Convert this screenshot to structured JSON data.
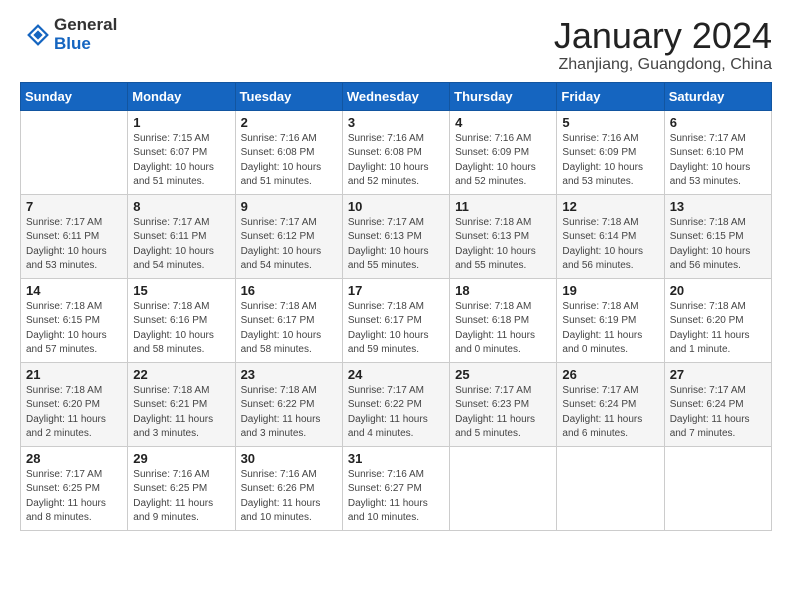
{
  "header": {
    "logo_general": "General",
    "logo_blue": "Blue",
    "title": "January 2024",
    "location": "Zhanjiang, Guangdong, China"
  },
  "weekdays": [
    "Sunday",
    "Monday",
    "Tuesday",
    "Wednesday",
    "Thursday",
    "Friday",
    "Saturday"
  ],
  "weeks": [
    [
      {
        "day": "",
        "sunrise": "",
        "sunset": "",
        "daylight": ""
      },
      {
        "day": "1",
        "sunrise": "7:15 AM",
        "sunset": "6:07 PM",
        "daylight": "10 hours and 51 minutes."
      },
      {
        "day": "2",
        "sunrise": "7:16 AM",
        "sunset": "6:08 PM",
        "daylight": "10 hours and 51 minutes."
      },
      {
        "day": "3",
        "sunrise": "7:16 AM",
        "sunset": "6:08 PM",
        "daylight": "10 hours and 52 minutes."
      },
      {
        "day": "4",
        "sunrise": "7:16 AM",
        "sunset": "6:09 PM",
        "daylight": "10 hours and 52 minutes."
      },
      {
        "day": "5",
        "sunrise": "7:16 AM",
        "sunset": "6:09 PM",
        "daylight": "10 hours and 53 minutes."
      },
      {
        "day": "6",
        "sunrise": "7:17 AM",
        "sunset": "6:10 PM",
        "daylight": "10 hours and 53 minutes."
      }
    ],
    [
      {
        "day": "7",
        "sunrise": "7:17 AM",
        "sunset": "6:11 PM",
        "daylight": "10 hours and 53 minutes."
      },
      {
        "day": "8",
        "sunrise": "7:17 AM",
        "sunset": "6:11 PM",
        "daylight": "10 hours and 54 minutes."
      },
      {
        "day": "9",
        "sunrise": "7:17 AM",
        "sunset": "6:12 PM",
        "daylight": "10 hours and 54 minutes."
      },
      {
        "day": "10",
        "sunrise": "7:17 AM",
        "sunset": "6:13 PM",
        "daylight": "10 hours and 55 minutes."
      },
      {
        "day": "11",
        "sunrise": "7:18 AM",
        "sunset": "6:13 PM",
        "daylight": "10 hours and 55 minutes."
      },
      {
        "day": "12",
        "sunrise": "7:18 AM",
        "sunset": "6:14 PM",
        "daylight": "10 hours and 56 minutes."
      },
      {
        "day": "13",
        "sunrise": "7:18 AM",
        "sunset": "6:15 PM",
        "daylight": "10 hours and 56 minutes."
      }
    ],
    [
      {
        "day": "14",
        "sunrise": "7:18 AM",
        "sunset": "6:15 PM",
        "daylight": "10 hours and 57 minutes."
      },
      {
        "day": "15",
        "sunrise": "7:18 AM",
        "sunset": "6:16 PM",
        "daylight": "10 hours and 58 minutes."
      },
      {
        "day": "16",
        "sunrise": "7:18 AM",
        "sunset": "6:17 PM",
        "daylight": "10 hours and 58 minutes."
      },
      {
        "day": "17",
        "sunrise": "7:18 AM",
        "sunset": "6:17 PM",
        "daylight": "10 hours and 59 minutes."
      },
      {
        "day": "18",
        "sunrise": "7:18 AM",
        "sunset": "6:18 PM",
        "daylight": "11 hours and 0 minutes."
      },
      {
        "day": "19",
        "sunrise": "7:18 AM",
        "sunset": "6:19 PM",
        "daylight": "11 hours and 0 minutes."
      },
      {
        "day": "20",
        "sunrise": "7:18 AM",
        "sunset": "6:20 PM",
        "daylight": "11 hours and 1 minute."
      }
    ],
    [
      {
        "day": "21",
        "sunrise": "7:18 AM",
        "sunset": "6:20 PM",
        "daylight": "11 hours and 2 minutes."
      },
      {
        "day": "22",
        "sunrise": "7:18 AM",
        "sunset": "6:21 PM",
        "daylight": "11 hours and 3 minutes."
      },
      {
        "day": "23",
        "sunrise": "7:18 AM",
        "sunset": "6:22 PM",
        "daylight": "11 hours and 3 minutes."
      },
      {
        "day": "24",
        "sunrise": "7:17 AM",
        "sunset": "6:22 PM",
        "daylight": "11 hours and 4 minutes."
      },
      {
        "day": "25",
        "sunrise": "7:17 AM",
        "sunset": "6:23 PM",
        "daylight": "11 hours and 5 minutes."
      },
      {
        "day": "26",
        "sunrise": "7:17 AM",
        "sunset": "6:24 PM",
        "daylight": "11 hours and 6 minutes."
      },
      {
        "day": "27",
        "sunrise": "7:17 AM",
        "sunset": "6:24 PM",
        "daylight": "11 hours and 7 minutes."
      }
    ],
    [
      {
        "day": "28",
        "sunrise": "7:17 AM",
        "sunset": "6:25 PM",
        "daylight": "11 hours and 8 minutes."
      },
      {
        "day": "29",
        "sunrise": "7:16 AM",
        "sunset": "6:25 PM",
        "daylight": "11 hours and 9 minutes."
      },
      {
        "day": "30",
        "sunrise": "7:16 AM",
        "sunset": "6:26 PM",
        "daylight": "11 hours and 10 minutes."
      },
      {
        "day": "31",
        "sunrise": "7:16 AM",
        "sunset": "6:27 PM",
        "daylight": "11 hours and 10 minutes."
      },
      {
        "day": "",
        "sunrise": "",
        "sunset": "",
        "daylight": ""
      },
      {
        "day": "",
        "sunrise": "",
        "sunset": "",
        "daylight": ""
      },
      {
        "day": "",
        "sunrise": "",
        "sunset": "",
        "daylight": ""
      }
    ]
  ],
  "labels": {
    "sunrise": "Sunrise:",
    "sunset": "Sunset:",
    "daylight": "Daylight:"
  }
}
